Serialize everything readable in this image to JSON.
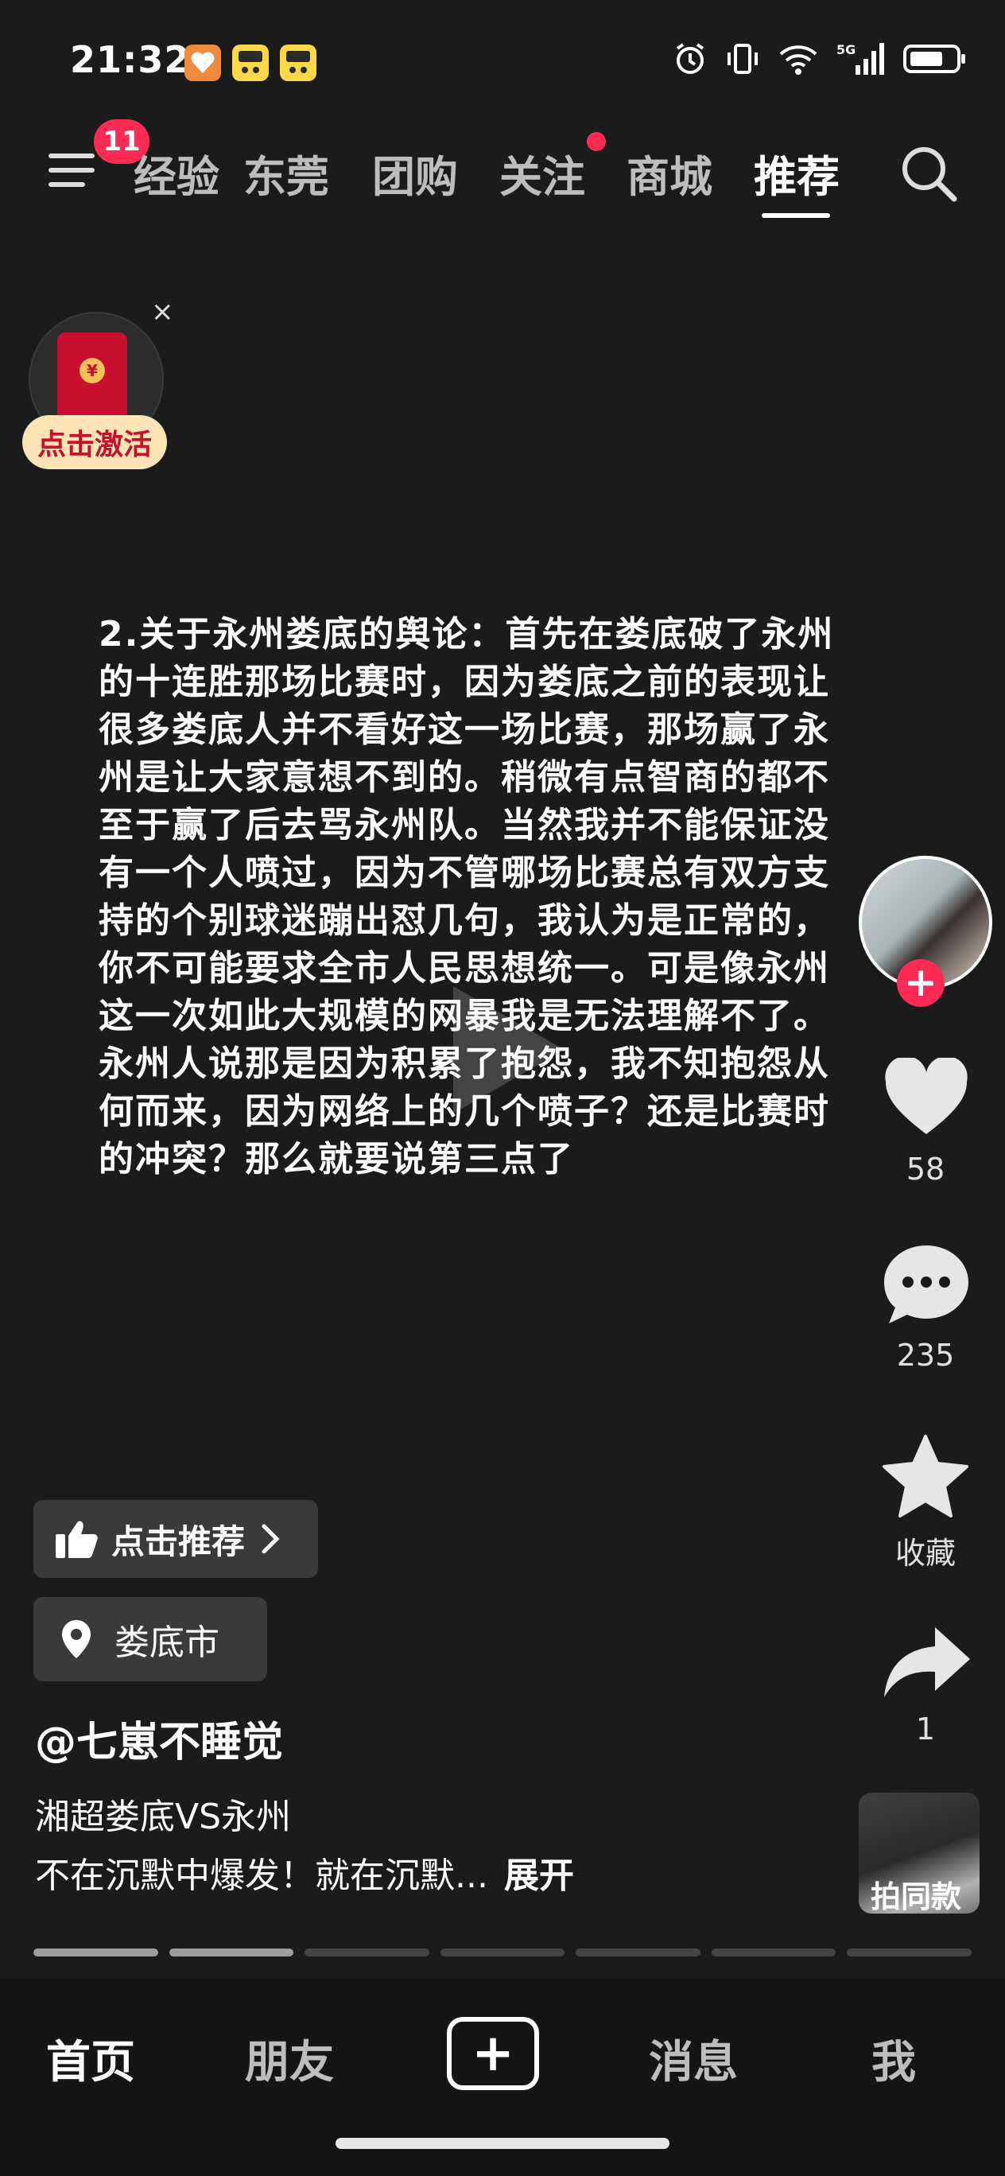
{
  "status_bar": {
    "time": "21:32",
    "network": "5G"
  },
  "top_nav": {
    "menu_badge": "11",
    "tabs": [
      "经验",
      "东莞",
      "团购",
      "关注",
      "商城",
      "推荐"
    ],
    "active_tab": "推荐"
  },
  "red_packet": {
    "label": "点击激活",
    "close": "×",
    "coin": "¥"
  },
  "post": {
    "text": "2.关于永州娄底的舆论：首先在娄底破了永州\n的十连胜那场比赛时，因为娄底之前的表现让\n很多娄底人并不看好这一场比赛，那场赢了永\n州是让大家意想不到的。稍微有点智商的都不\n至于赢了后去骂永州队。当然我并不能保证没\n有一个人喷过，因为不管哪场比赛总有双方支\n持的个别球迷蹦出怼几句，我认为是正常的，\n你不可能要求全市人民思想统一。可是像永州\n这一次如此大规模的网暴我是无法理解不了。\n永州人说那是因为积累了抱怨，我不知抱怨从\n何而来，因为网络上的几个喷子？还是比赛时\n的冲突？那么就要说第三点了"
  },
  "side_actions": {
    "follow": "+",
    "likes": "58",
    "comments": "235",
    "favorite_label": "收藏",
    "shares": "1",
    "remix_label": "拍同款"
  },
  "chips": {
    "recommend": "点击推荐",
    "location": "娄底市"
  },
  "author": "@七崽不睡觉",
  "caption": {
    "line1": "湘超娄底VS永州",
    "line2": "不在沉默中爆发！就在沉默...",
    "expand": "展开"
  },
  "progress": {
    "segments": 7,
    "completed": 2
  },
  "bottom_nav": {
    "home": "首页",
    "friends": "朋友",
    "create": "+",
    "messages": "消息",
    "me": "我"
  }
}
